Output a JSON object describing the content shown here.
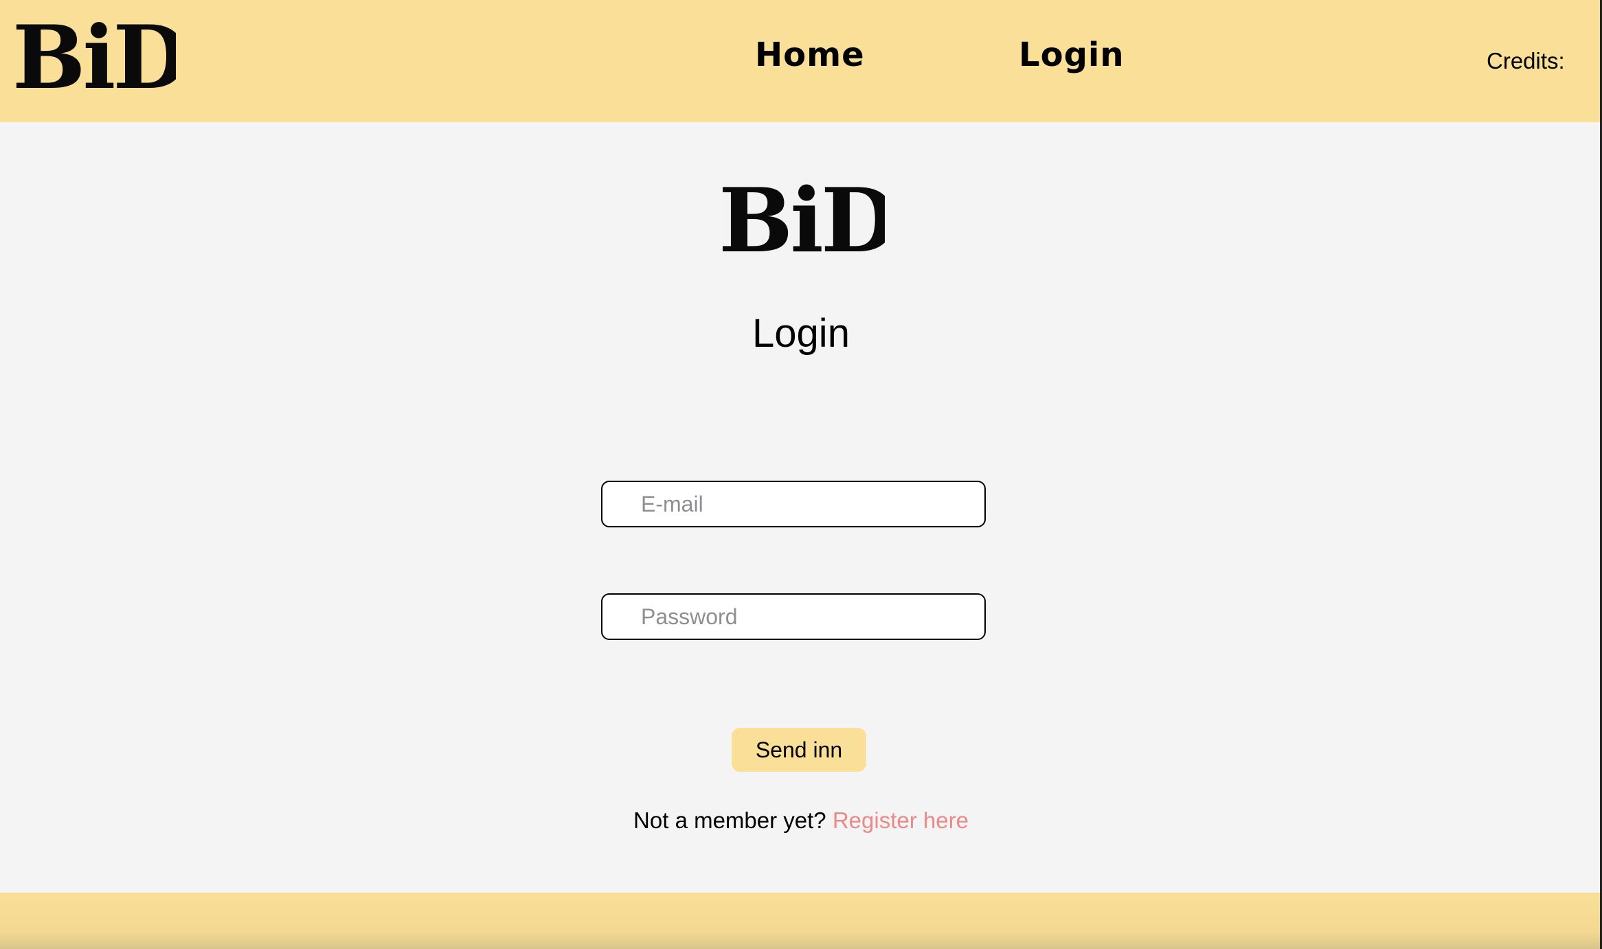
{
  "header": {
    "logo_text": "BiD",
    "nav": [
      {
        "label": "Home"
      },
      {
        "label": "Login"
      }
    ],
    "credits_label": "Credits:"
  },
  "main": {
    "logo_text": "BiD",
    "title": "Login",
    "email_placeholder": "E-mail",
    "password_placeholder": "Password",
    "submit_label": "Send inn",
    "register_prompt": "Not a member yet?",
    "register_link": "Register here"
  },
  "colors": {
    "header_bg": "#fadf98",
    "page_bg": "#f4f4f4",
    "link": "#ec8a8a",
    "button_bg": "#fadf98"
  }
}
